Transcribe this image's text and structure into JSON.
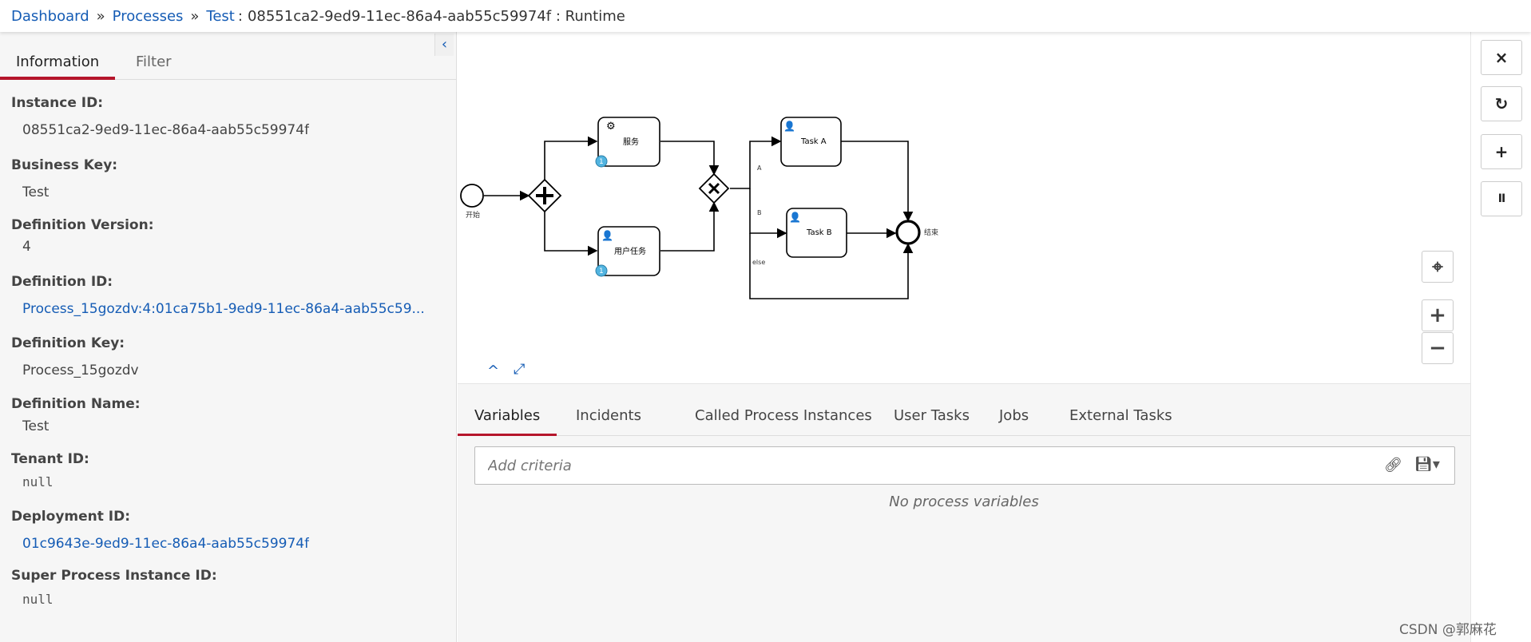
{
  "breadcrumb": {
    "dashboard": "Dashboard",
    "sep1": "»",
    "processes": "Processes",
    "sep2": "»",
    "test": "Test",
    "colon": ":",
    "current": "08551ca2-9ed9-11ec-86a4-aab55c59974f : Runtime"
  },
  "left_panel": {
    "collapse_icon": "chevron-left-icon",
    "tabs": [
      "Information",
      "Filter"
    ],
    "active_tab": "Information",
    "fields": {
      "instance_id": {
        "label": "Instance ID:",
        "value": "08551ca2-9ed9-11ec-86a4-aab55c59974f"
      },
      "business_key": {
        "label": "Business Key:",
        "value": "Test"
      },
      "definition_version": {
        "label": "Definition Version:",
        "value": "4"
      },
      "definition_id": {
        "label": "Definition ID:",
        "value": "Process_15gozdv:4:01ca75b1-9ed9-11ec-86a4-aab55c59..."
      },
      "definition_key": {
        "label": "Definition Key:",
        "value": "Process_15gozdv"
      },
      "definition_name": {
        "label": "Definition Name:",
        "value": "Test"
      },
      "tenant_id": {
        "label": "Tenant ID:",
        "value": "null"
      },
      "deployment_id": {
        "label": "Deployment ID:",
        "value": "01c9643e-9ed9-11ec-86a4-aab55c59974f"
      },
      "super_process_instance_id": {
        "label": "Super Process Instance ID:",
        "value": "null"
      }
    }
  },
  "diagram": {
    "start_label": "开始",
    "end_label": "结束",
    "service_task": "服务",
    "user_task": "用户任务",
    "task_a": "Task A",
    "task_b": "Task B",
    "flow_a": "A",
    "flow_b": "B",
    "flow_else": "else",
    "badge_service": "1",
    "badge_user": "1",
    "controls": {
      "collapse": "^",
      "fullscreen": "⤢"
    }
  },
  "right_toolbar": {
    "cancel": "×",
    "retry": "↻",
    "add": "+",
    "suspend": "II",
    "zoom_reset": "⌖",
    "zoom_in": "+",
    "zoom_out": "−"
  },
  "bottom_tabs": [
    "Variables",
    "Incidents",
    "Called Process Instances",
    "User Tasks",
    "Jobs",
    "External Tasks"
  ],
  "active_bottom_tab": "Variables",
  "search": {
    "placeholder": "Add criteria"
  },
  "empty_message": "No process variables",
  "watermark": "CSDN @郭麻花",
  "colors": {
    "link": "#155cb5",
    "active_tab": "#b5152b",
    "badge": "#52b4e0"
  }
}
